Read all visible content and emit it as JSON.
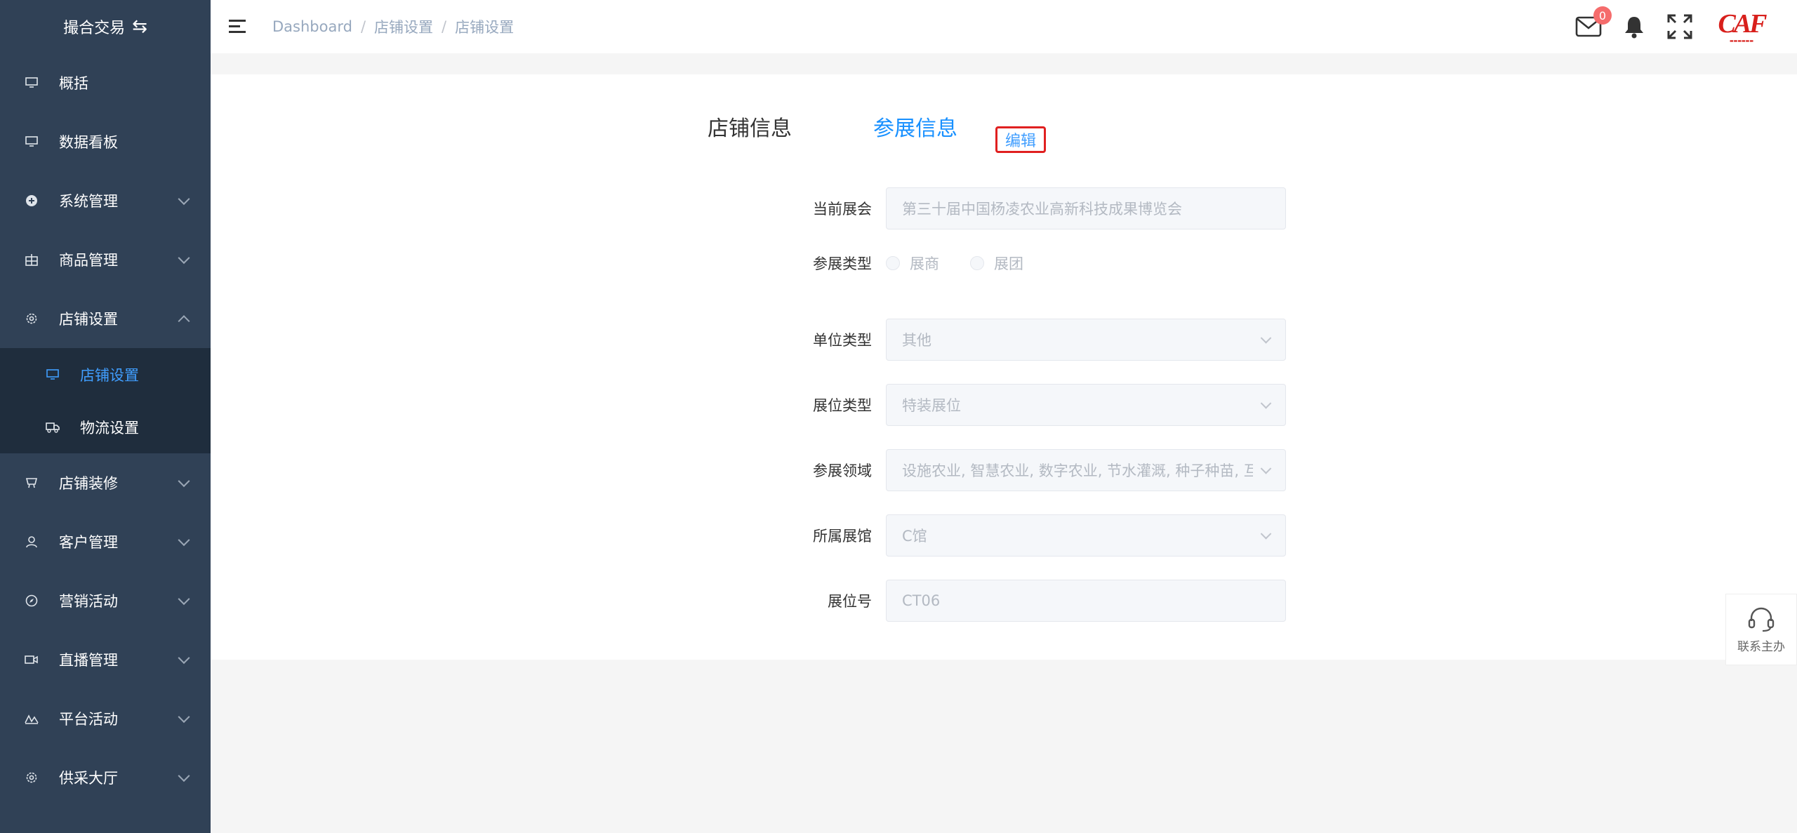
{
  "sidebar": {
    "brand": "撮合交易",
    "items": [
      {
        "label": "概括",
        "icon": "monitor-icon",
        "expandable": false
      },
      {
        "label": "数据看板",
        "icon": "monitor-icon",
        "expandable": false
      },
      {
        "label": "系统管理",
        "icon": "plus-circle-icon",
        "expandable": true
      },
      {
        "label": "商品管理",
        "icon": "goods-icon",
        "expandable": true
      },
      {
        "label": "店铺设置",
        "icon": "gear-icon",
        "expandable": true,
        "expanded": true,
        "children": [
          {
            "label": "店铺设置",
            "icon": "monitor-icon",
            "active": true
          },
          {
            "label": "物流设置",
            "icon": "truck-icon",
            "active": false
          }
        ]
      },
      {
        "label": "店铺装修",
        "icon": "shop-icon",
        "expandable": true
      },
      {
        "label": "客户管理",
        "icon": "user-icon",
        "expandable": true
      },
      {
        "label": "营销活动",
        "icon": "compass-icon",
        "expandable": true
      },
      {
        "label": "直播管理",
        "icon": "video-icon",
        "expandable": true
      },
      {
        "label": "平台活动",
        "icon": "activity-icon",
        "expandable": true
      },
      {
        "label": "供采大厅",
        "icon": "gear-icon",
        "expandable": true
      }
    ]
  },
  "header": {
    "breadcrumb": [
      "Dashboard",
      "店铺设置",
      "店铺设置"
    ],
    "mail_badge": "0",
    "logo_text": "CAF"
  },
  "main": {
    "tabs": [
      {
        "label": "店铺信息",
        "active": false
      },
      {
        "label": "参展信息",
        "active": true
      }
    ],
    "edit_label": "编辑",
    "form": {
      "exhibition": {
        "label": "当前展会",
        "value": "第三十届中国杨凌农业高新科技成果博览会"
      },
      "participation_type": {
        "label": "参展类型",
        "options": [
          "展商",
          "展团"
        ]
      },
      "unit_type": {
        "label": "单位类型",
        "value": "其他"
      },
      "booth_type": {
        "label": "展位类型",
        "value": "特装展位"
      },
      "field": {
        "label": "参展领域",
        "value": "设施农业, 智慧农业, 数字农业, 节水灌溉, 种子种苗, 互"
      },
      "hall": {
        "label": "所属展馆",
        "value": "C馆"
      },
      "booth_no": {
        "label": "展位号",
        "value": "CT06"
      }
    }
  },
  "contact": {
    "label": "联系主办"
  },
  "colors": {
    "sidebar_bg": "#304156",
    "submenu_bg": "#1f2d3d",
    "accent": "#409eff",
    "tab_active": "#1890ff",
    "badge": "#f56c6c",
    "edit_border": "#e02020"
  }
}
